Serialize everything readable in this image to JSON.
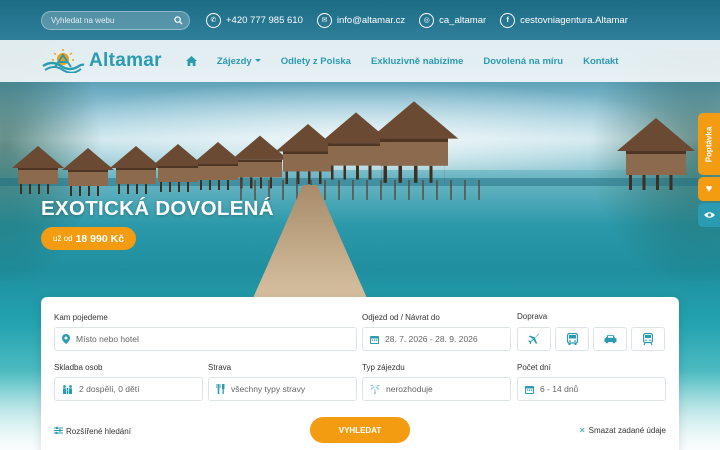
{
  "topbar": {
    "search_placeholder": "Vyhledat na webu",
    "phone": "+420 777 985 610",
    "email": "info@altamar.cz",
    "instagram": "ca_altamar",
    "facebook": "cestovniagentura.Altamar"
  },
  "nav": {
    "logo_text": "Altamar",
    "items": [
      {
        "label": "Zájezdy"
      },
      {
        "label": "Odlety z Polska"
      },
      {
        "label": "Exkluzivně nabízíme"
      },
      {
        "label": "Dovolená na míru"
      },
      {
        "label": "Kontakt"
      }
    ]
  },
  "hero": {
    "title": "EXOTICKÁ DOVOLENÁ",
    "price_prefix": "už od",
    "price_value": "18 990 Kč"
  },
  "side": {
    "poptavka": "Poptávka"
  },
  "search_form": {
    "destination_label": "Kam pojedeme",
    "destination_placeholder": "Místo nebo hotel",
    "dates_label": "Odjezd od / Návrat do",
    "dates_value": "28. 7. 2026 - 28. 9. 2026",
    "transport_label": "Doprava",
    "persons_label": "Skladba osob",
    "persons_value": "2 dospělí, 0 dětí",
    "board_label": "Strava",
    "board_value": "všechny typy stravy",
    "trip_type_label": "Typ zájezdu",
    "trip_type_value": "nerozhoduje",
    "days_label": "Počet dní",
    "days_value": "6 - 14 dnů",
    "advanced_label": "Rozšířené hledání",
    "search_button": "VYHLEDAT",
    "clear_label": "Smazat zadané údaje"
  },
  "colors": {
    "accent": "#f39c12",
    "brand": "#2a9bb0"
  }
}
